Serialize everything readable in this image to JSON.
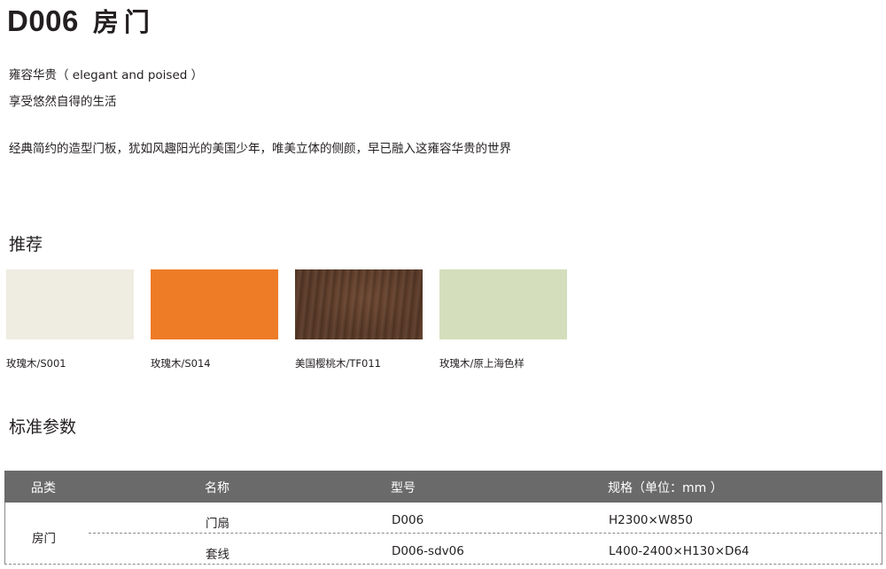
{
  "product": {
    "code": "D006",
    "name": "房门"
  },
  "description": {
    "line1": "雍容华贵（ elegant and poised ）",
    "line2": "享受悠然自得的生活",
    "line3": "经典简约的造型门板，犹如风趣阳光的美国少年，唯美立体的侧颜，早已融入这雍容华贵的世界"
  },
  "recommend": {
    "heading": "推荐",
    "swatches": [
      {
        "label": "玫瑰木/S001",
        "color": "#efece2"
      },
      {
        "label": "玫瑰木/S014",
        "color": "#ee7b26"
      },
      {
        "label": "美国樱桃木/TF011",
        "color": "#5a3a28"
      },
      {
        "label": "玫瑰木/原上海色样",
        "color": "#d4ddbc"
      }
    ]
  },
  "specs": {
    "heading": "标准参数",
    "headers": [
      "品类",
      "名称",
      "型号",
      "规格（单位：mm ）"
    ],
    "category": "房门",
    "rows": [
      {
        "name": "门扇",
        "model": "D006",
        "size": "H2300×W850"
      },
      {
        "name": "套线",
        "model": "D006-sdv06",
        "size": "L400-2400×H130×D64"
      }
    ]
  }
}
